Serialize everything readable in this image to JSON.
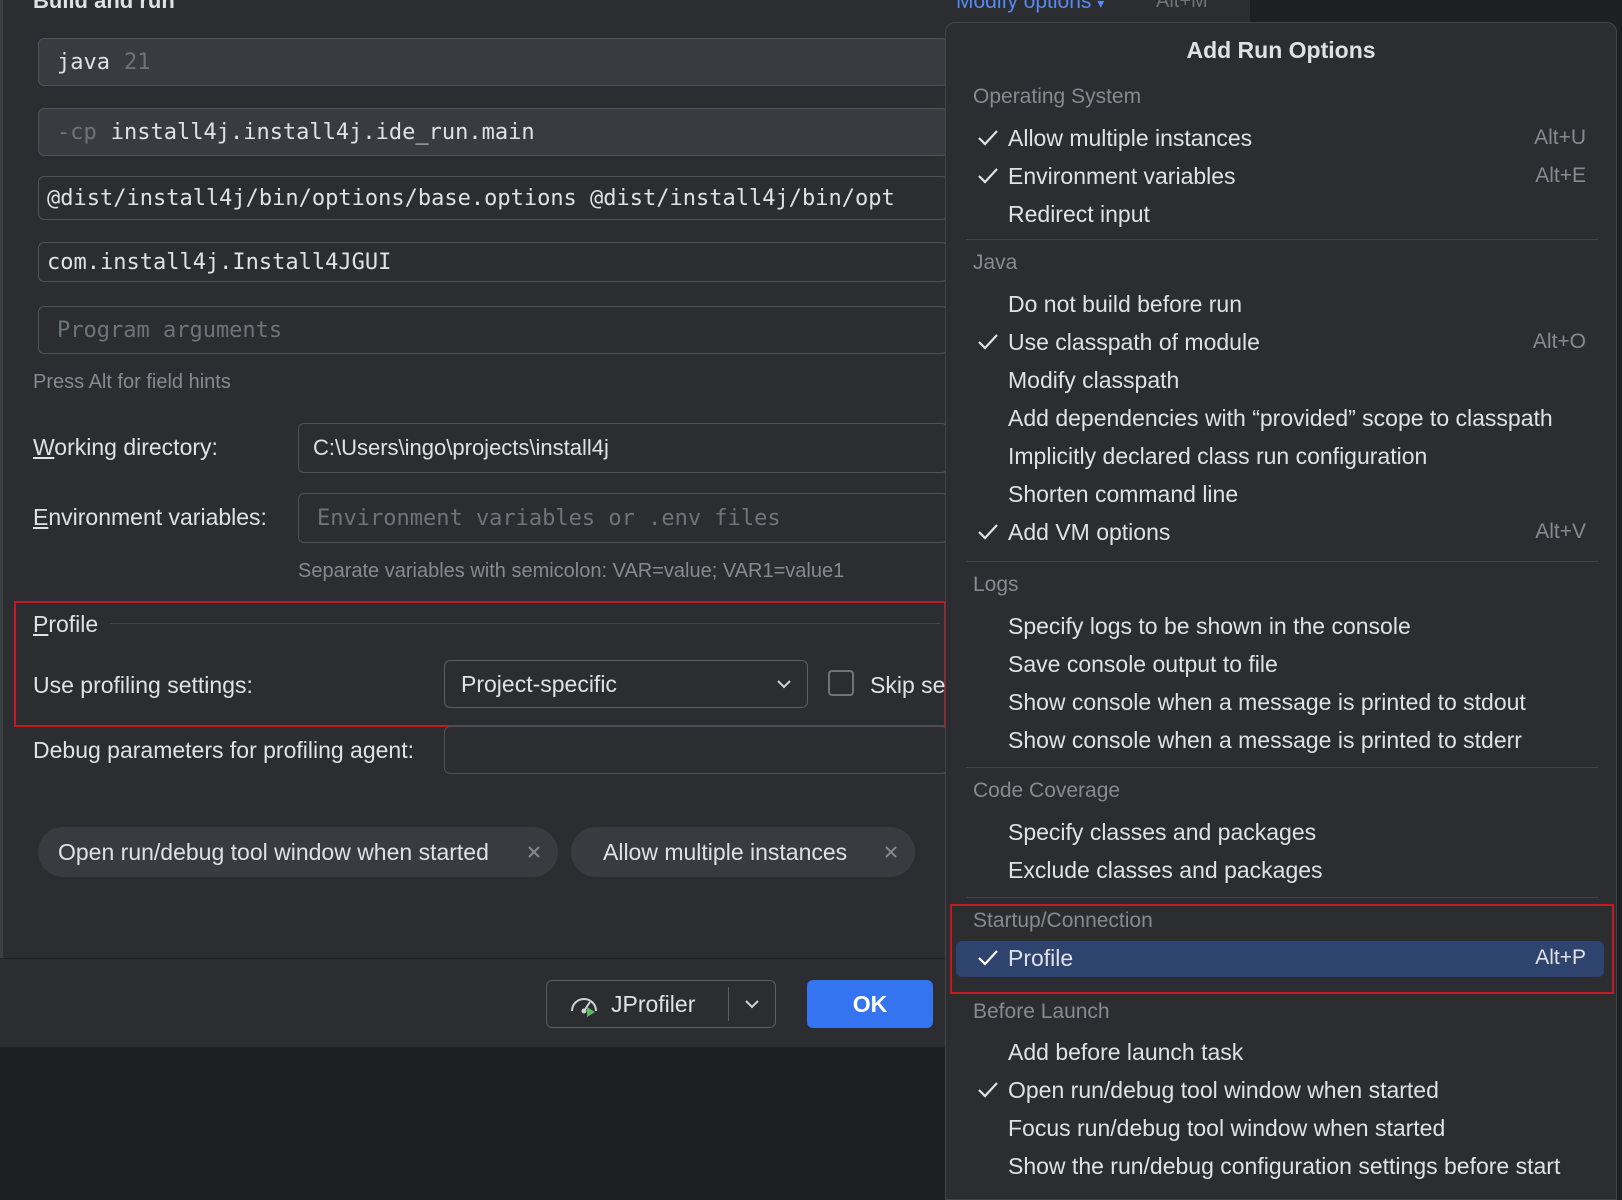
{
  "header": {
    "section_title": "Build and run",
    "modify_options": "Modify options",
    "modify_shortcut": "Alt+M"
  },
  "form": {
    "java_field": {
      "value": "java",
      "suffix": "21"
    },
    "classpath_field": {
      "prefix": "-cp",
      "value": "install4j.install4j.ide_run.main"
    },
    "vm_options": "@dist/install4j/bin/options/base.options @dist/install4j/bin/opt",
    "main_class": "com.install4j.Install4JGUI",
    "program_args_placeholder": "Program arguments",
    "field_hint": "Press Alt for field hints",
    "working_dir_label_first": "W",
    "working_dir_label_rest": "orking directory:",
    "working_dir_value": "C:\\Users\\ingo\\projects\\install4j",
    "env_label_first": "E",
    "env_label_rest": "nvironment variables:",
    "env_placeholder": "Environment variables or .env files",
    "env_hint": "Separate variables with semicolon: VAR=value; VAR1=value1"
  },
  "profile_group": {
    "title_first": "P",
    "title_rest": "rofile",
    "use_settings_label": "Use profiling settings:",
    "dropdown_value": "Project-specific",
    "skip_label": "Skip se",
    "skip_checked": false,
    "debug_params_label": "Debug parameters for profiling agent:"
  },
  "chips": [
    {
      "label": "Open run/debug tool window when started"
    },
    {
      "label": "Allow multiple instances"
    }
  ],
  "footer": {
    "jprofiler_label": "JProfiler",
    "ok_label": "OK"
  },
  "popup": {
    "title": "Add Run Options",
    "categories": {
      "os": "Operating System",
      "java": "Java",
      "logs": "Logs",
      "coverage": "Code Coverage",
      "startup": "Startup/Connection",
      "before": "Before Launch"
    },
    "items": [
      {
        "label": "Allow multiple instances",
        "checked": true,
        "shortcut": "Alt+U"
      },
      {
        "label": "Environment variables",
        "checked": true,
        "shortcut": "Alt+E"
      },
      {
        "label": "Redirect input",
        "checked": false,
        "shortcut": ""
      },
      {
        "label": "Do not build before run",
        "checked": false,
        "shortcut": ""
      },
      {
        "label": "Use classpath of module",
        "checked": true,
        "shortcut": "Alt+O"
      },
      {
        "label": "Modify classpath",
        "checked": false,
        "shortcut": ""
      },
      {
        "label": "Add dependencies with “provided” scope to classpath",
        "checked": false,
        "shortcut": ""
      },
      {
        "label": "Implicitly declared class run configuration",
        "checked": false,
        "shortcut": ""
      },
      {
        "label": "Shorten command line",
        "checked": false,
        "shortcut": ""
      },
      {
        "label": "Add VM options",
        "checked": true,
        "shortcut": "Alt+V"
      },
      {
        "label": "Specify logs to be shown in the console",
        "checked": false,
        "shortcut": ""
      },
      {
        "label": "Save console output to file",
        "checked": false,
        "shortcut": ""
      },
      {
        "label": "Show console when a message is printed to stdout",
        "checked": false,
        "shortcut": ""
      },
      {
        "label": "Show console when a message is printed to stderr",
        "checked": false,
        "shortcut": ""
      },
      {
        "label": "Specify classes and packages",
        "checked": false,
        "shortcut": ""
      },
      {
        "label": "Exclude classes and packages",
        "checked": false,
        "shortcut": ""
      },
      {
        "label": "Profile",
        "checked": true,
        "shortcut": "Alt+P",
        "selected": true
      },
      {
        "label": "Add before launch task",
        "checked": false,
        "shortcut": ""
      },
      {
        "label": "Open run/debug tool window when started",
        "checked": true,
        "shortcut": ""
      },
      {
        "label": "Focus run/debug tool window when started",
        "checked": false,
        "shortcut": ""
      },
      {
        "label": "Show the run/debug configuration settings before start",
        "checked": false,
        "shortcut": ""
      }
    ]
  },
  "colors": {
    "background": "#1e1f22",
    "panel": "#2b2d30",
    "field": "#393b40",
    "accent": "#3574f0",
    "selection": "#2e436e",
    "highlight_border": "#c41922",
    "link": "#548af7"
  }
}
